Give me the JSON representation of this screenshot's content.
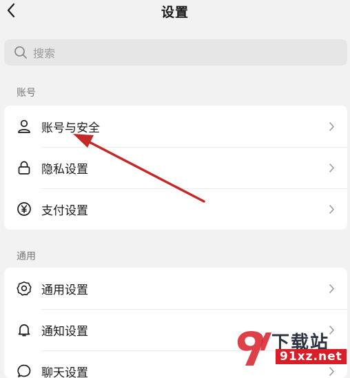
{
  "header": {
    "title": "设置"
  },
  "search": {
    "placeholder": "搜索"
  },
  "sections": {
    "account": {
      "label": "账号",
      "items": [
        {
          "label": "账号与安全",
          "icon": "person-icon"
        },
        {
          "label": "隐私设置",
          "icon": "lock-icon"
        },
        {
          "label": "支付设置",
          "icon": "yen-icon"
        }
      ]
    },
    "general": {
      "label": "通用",
      "items": [
        {
          "label": "通用设置",
          "icon": "gear-icon"
        },
        {
          "label": "通知设置",
          "icon": "bell-icon"
        },
        {
          "label": "聊天设置",
          "icon": "chat-icon"
        }
      ]
    }
  },
  "watermark": {
    "brand_top": "下载站",
    "brand_bottom": "91xz.net"
  },
  "colors": {
    "annotation_arrow": "#c62828",
    "watermark_red": "#d81e28"
  }
}
